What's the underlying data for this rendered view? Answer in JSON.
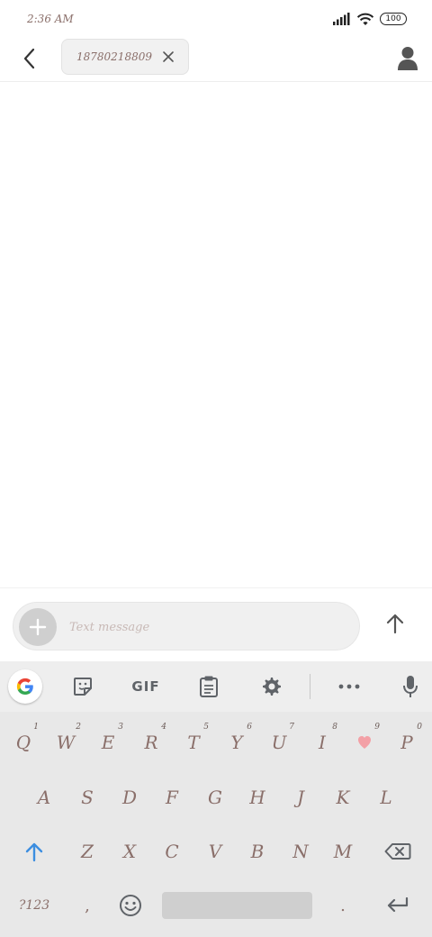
{
  "status_bar": {
    "time": "2:36 AM",
    "battery": "100"
  },
  "header": {
    "recipient": "18780218809"
  },
  "compose": {
    "placeholder": "Text message"
  },
  "keyboard": {
    "toolbar": {
      "gif_label": "GIF"
    },
    "rows": [
      [
        {
          "label": "Q",
          "hint": "1"
        },
        {
          "label": "W",
          "hint": "2"
        },
        {
          "label": "E",
          "hint": "3"
        },
        {
          "label": "R",
          "hint": "4"
        },
        {
          "label": "T",
          "hint": "5"
        },
        {
          "label": "Y",
          "hint": "6"
        },
        {
          "label": "U",
          "hint": "7"
        },
        {
          "label": "I",
          "hint": "8"
        },
        {
          "label": "",
          "hint": "9"
        },
        {
          "label": "P",
          "hint": "0"
        }
      ],
      [
        {
          "label": "A"
        },
        {
          "label": "S"
        },
        {
          "label": "D"
        },
        {
          "label": "F"
        },
        {
          "label": "G"
        },
        {
          "label": "H"
        },
        {
          "label": "J"
        },
        {
          "label": "K"
        },
        {
          "label": "L"
        }
      ],
      [
        {
          "label": "Z"
        },
        {
          "label": "X"
        },
        {
          "label": "C"
        },
        {
          "label": "V"
        },
        {
          "label": "B"
        },
        {
          "label": "N"
        },
        {
          "label": "M"
        }
      ]
    ],
    "bottom": {
      "symbols": "?123",
      "comma": ",",
      "period": "."
    }
  },
  "colors": {
    "key_text": "#8a6f6a",
    "shift_blue": "#3c8ee0",
    "heart_pink": "#f3a0a6",
    "icon_gray": "#5f6368"
  }
}
